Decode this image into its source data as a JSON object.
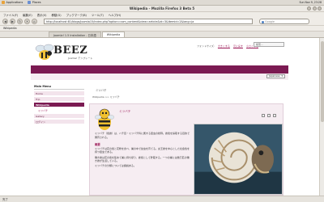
{
  "panel": {
    "apps_label": "Applications",
    "places_label": "Places",
    "clock": "Sun Nov 9, 23:28"
  },
  "window": {
    "title": "Wikipedia – Mozilla Firefox 3 Beta 5"
  },
  "menu": [
    "ファイル(F)",
    "編集(E)",
    "表示(V)",
    "移動(G)",
    "ブックマーク(B)",
    "ツール(T)",
    "ヘルプ(H)"
  ],
  "nav": {
    "url": "http://localhost:81/blogs/joomla15/index.php?option=com_content&view=article&id=3&Itemid=2&lang=ja",
    "search_placeholder": "Google"
  },
  "bookmarks": {
    "item": "Wikipedia"
  },
  "tabs": [
    {
      "label": "Joomla! 1.5 Installation - 日本語"
    },
    {
      "label": "Wikipedia"
    }
  ],
  "site": {
    "logo": "BEEZ",
    "logo_sub": "Joomla! テンプレート",
    "access_label": "フォントサイズ:",
    "access_buttons": [
      "大きくする",
      "元に戻す",
      "小さくする"
    ],
    "search_placeholder": "検索...",
    "language": "Japanese"
  },
  "leftmenu": {
    "header": "Main Menu",
    "items": [
      {
        "label": "Home"
      },
      {
        "label": "Trip"
      },
      {
        "label": "Wikipedia"
      },
      {
        "label": "ミツバチ"
      },
      {
        "label": "Gallery"
      },
      {
        "label": "ログイン"
      }
    ]
  },
  "breadcrumb": "ミツバチ",
  "crumb2": "Wikipedia >> ミツバチ",
  "article": {
    "title": "ミツバチ",
    "intro": "ミツバチ（蜜蜂）は、ハチ目・ミツバチ科に属する昆虫の総称。蜂蜜を採取する目的で飼育される。",
    "heading": "概要",
    "p1": "ミツバチは花の蜜と花粉を食べ、巣の中で幼虫を育てる。女王蜂を中心とした社会性を持つ昆虫である。",
    "p2": "働き蜂は花の蜜を集めて巣に持ち帰り、蜂蜜として貯蔵する。一つの巣には数万匹の働き蜂が生活している。",
    "p3": "ミツバチの分類については諸説ある。"
  },
  "status": "完了"
}
